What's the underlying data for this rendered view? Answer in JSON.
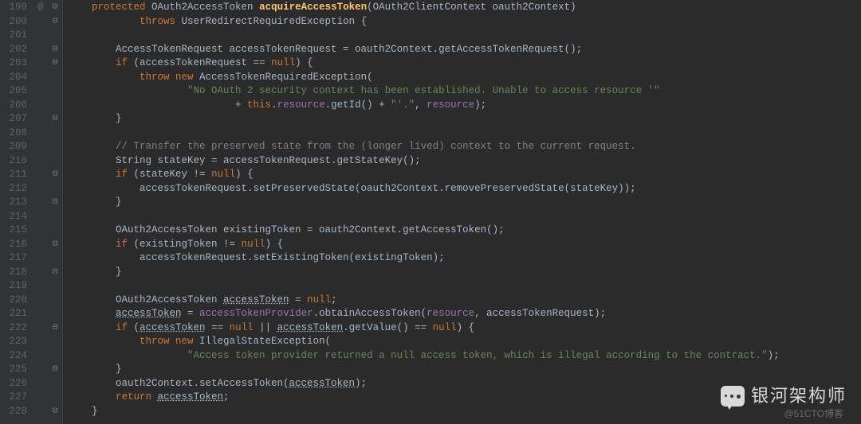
{
  "lines": {
    "start": 199,
    "end": 228
  },
  "vcs_marker": {
    "line": 199,
    "symbol": "@"
  },
  "fold_lines": [
    199,
    200,
    202,
    203,
    207,
    211,
    213,
    216,
    218,
    222,
    225,
    228
  ],
  "code_tokens": [
    [
      [
        "    ",
        ""
      ],
      [
        "protected ",
        "kw"
      ],
      [
        "OAuth2AccessToken ",
        "type"
      ],
      [
        "acquireAccessToken",
        "method"
      ],
      [
        "(OAuth2ClientContext oauth2Context)",
        ""
      ]
    ],
    [
      [
        "            ",
        ""
      ],
      [
        "throws ",
        "kw"
      ],
      [
        "UserRedirectRequiredException {",
        ""
      ]
    ],
    [
      [
        "",
        ""
      ]
    ],
    [
      [
        "        AccessTokenRequest accessTokenRequest = oauth2Context.getAccessTokenRequest();",
        ""
      ]
    ],
    [
      [
        "        ",
        ""
      ],
      [
        "if ",
        "kw"
      ],
      [
        "(accessTokenRequest == ",
        ""
      ],
      [
        "null",
        "kw"
      ],
      [
        ") {",
        ""
      ]
    ],
    [
      [
        "            ",
        ""
      ],
      [
        "throw new ",
        "kw"
      ],
      [
        "AccessTokenRequiredException(",
        ""
      ]
    ],
    [
      [
        "                    ",
        ""
      ],
      [
        "\"No OAuth 2 security context has been established. Unable to access resource '\"",
        "str"
      ]
    ],
    [
      [
        "                            + ",
        ""
      ],
      [
        "this",
        "kw"
      ],
      [
        ".",
        ""
      ],
      [
        "resource",
        "field"
      ],
      [
        ".getId() + ",
        ""
      ],
      [
        "\"'.\"",
        "str"
      ],
      [
        ", ",
        ""
      ],
      [
        "resource",
        "field"
      ],
      [
        ");",
        ""
      ]
    ],
    [
      [
        "        }",
        ""
      ]
    ],
    [
      [
        "",
        ""
      ]
    ],
    [
      [
        "        ",
        ""
      ],
      [
        "// Transfer the preserved state from the (longer lived) context to the current request.",
        "comment"
      ]
    ],
    [
      [
        "        String stateKey = accessTokenRequest.getStateKey();",
        ""
      ]
    ],
    [
      [
        "        ",
        ""
      ],
      [
        "if ",
        "kw"
      ],
      [
        "(stateKey != ",
        ""
      ],
      [
        "null",
        "kw"
      ],
      [
        ") {",
        ""
      ]
    ],
    [
      [
        "            accessTokenRequest.setPreservedState(oauth2Context.removePreservedState(stateKey));",
        ""
      ]
    ],
    [
      [
        "        }",
        ""
      ]
    ],
    [
      [
        "",
        ""
      ]
    ],
    [
      [
        "        OAuth2AccessToken existingToken = oauth2Context.getAccessToken();",
        ""
      ]
    ],
    [
      [
        "        ",
        ""
      ],
      [
        "if ",
        "kw"
      ],
      [
        "(existingToken != ",
        ""
      ],
      [
        "null",
        "kw"
      ],
      [
        ") {",
        ""
      ]
    ],
    [
      [
        "            accessTokenRequest.setExistingToken(existingToken);",
        ""
      ]
    ],
    [
      [
        "        }",
        ""
      ]
    ],
    [
      [
        "",
        ""
      ]
    ],
    [
      [
        "        OAuth2AccessToken ",
        ""
      ],
      [
        "accessToken",
        "var-underline"
      ],
      [
        " = ",
        ""
      ],
      [
        "null",
        "kw"
      ],
      [
        ";",
        ""
      ]
    ],
    [
      [
        "        ",
        ""
      ],
      [
        "accessToken",
        "var-underline"
      ],
      [
        " = ",
        ""
      ],
      [
        "accessTokenProvider",
        "field"
      ],
      [
        ".obtainAccessToken(",
        ""
      ],
      [
        "resource",
        "field"
      ],
      [
        ", accessTokenRequest);",
        ""
      ]
    ],
    [
      [
        "        ",
        ""
      ],
      [
        "if ",
        "kw"
      ],
      [
        "(",
        ""
      ],
      [
        "accessToken",
        "var-underline"
      ],
      [
        " == ",
        ""
      ],
      [
        "null ",
        "kw"
      ],
      [
        "|| ",
        ""
      ],
      [
        "accessToken",
        "var-underline"
      ],
      [
        ".getValue() == ",
        ""
      ],
      [
        "null",
        "kw"
      ],
      [
        ") {",
        ""
      ]
    ],
    [
      [
        "            ",
        ""
      ],
      [
        "throw new ",
        "kw"
      ],
      [
        "IllegalStateException(",
        ""
      ]
    ],
    [
      [
        "                    ",
        ""
      ],
      [
        "\"Access token provider returned a null access token, which is illegal according to the contract.\"",
        "str"
      ],
      [
        ");",
        ""
      ]
    ],
    [
      [
        "        }",
        ""
      ]
    ],
    [
      [
        "        oauth2Context.setAccessToken(",
        ""
      ],
      [
        "accessToken",
        "var-underline"
      ],
      [
        ");",
        ""
      ]
    ],
    [
      [
        "        ",
        ""
      ],
      [
        "return ",
        "kw"
      ],
      [
        "accessToken",
        "var-underline"
      ],
      [
        ";",
        ""
      ]
    ],
    [
      [
        "    }",
        ""
      ]
    ]
  ],
  "watermark": {
    "brand": "银河架构师",
    "credit": "@51CTO博客"
  }
}
